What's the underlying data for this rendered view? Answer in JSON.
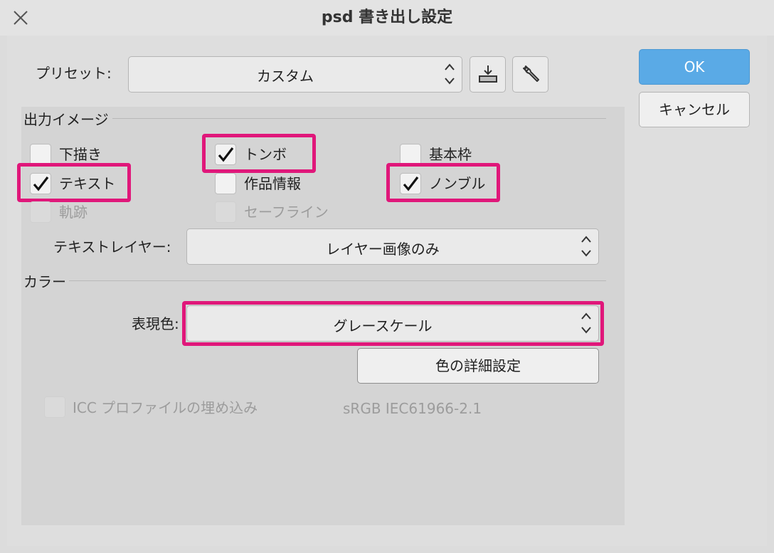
{
  "window": {
    "title": "psd 書き出し設定"
  },
  "preset": {
    "label": "プリセット:",
    "value": "カスタム"
  },
  "buttons": {
    "ok": "OK",
    "cancel": "キャンセル",
    "color_detail": "色の詳細設定"
  },
  "output_image": {
    "heading": "出力イメージ",
    "checkboxes": [
      {
        "label": "下描き",
        "checked": false
      },
      {
        "label": "トンボ",
        "checked": true
      },
      {
        "label": "基本枠",
        "checked": false
      },
      {
        "label": "テキスト",
        "checked": true
      },
      {
        "label": "作品情報",
        "checked": false
      },
      {
        "label": "ノンブル",
        "checked": true
      },
      {
        "label": "軌跡",
        "checked": false,
        "disabled": true
      },
      {
        "label": "セーフライン",
        "checked": false,
        "disabled": true
      }
    ],
    "text_layer": {
      "label": "テキストレイヤー:",
      "value": "レイヤー画像のみ"
    }
  },
  "color": {
    "heading": "カラー",
    "mode_label": "表現色:",
    "mode_value": "グレースケール",
    "icc_label": "ICC プロファイルの埋め込み",
    "icc_profile": "sRGB IEC61966-2.1"
  },
  "colors": {
    "accent": "#5aaae6",
    "highlight": "#e0177a"
  }
}
